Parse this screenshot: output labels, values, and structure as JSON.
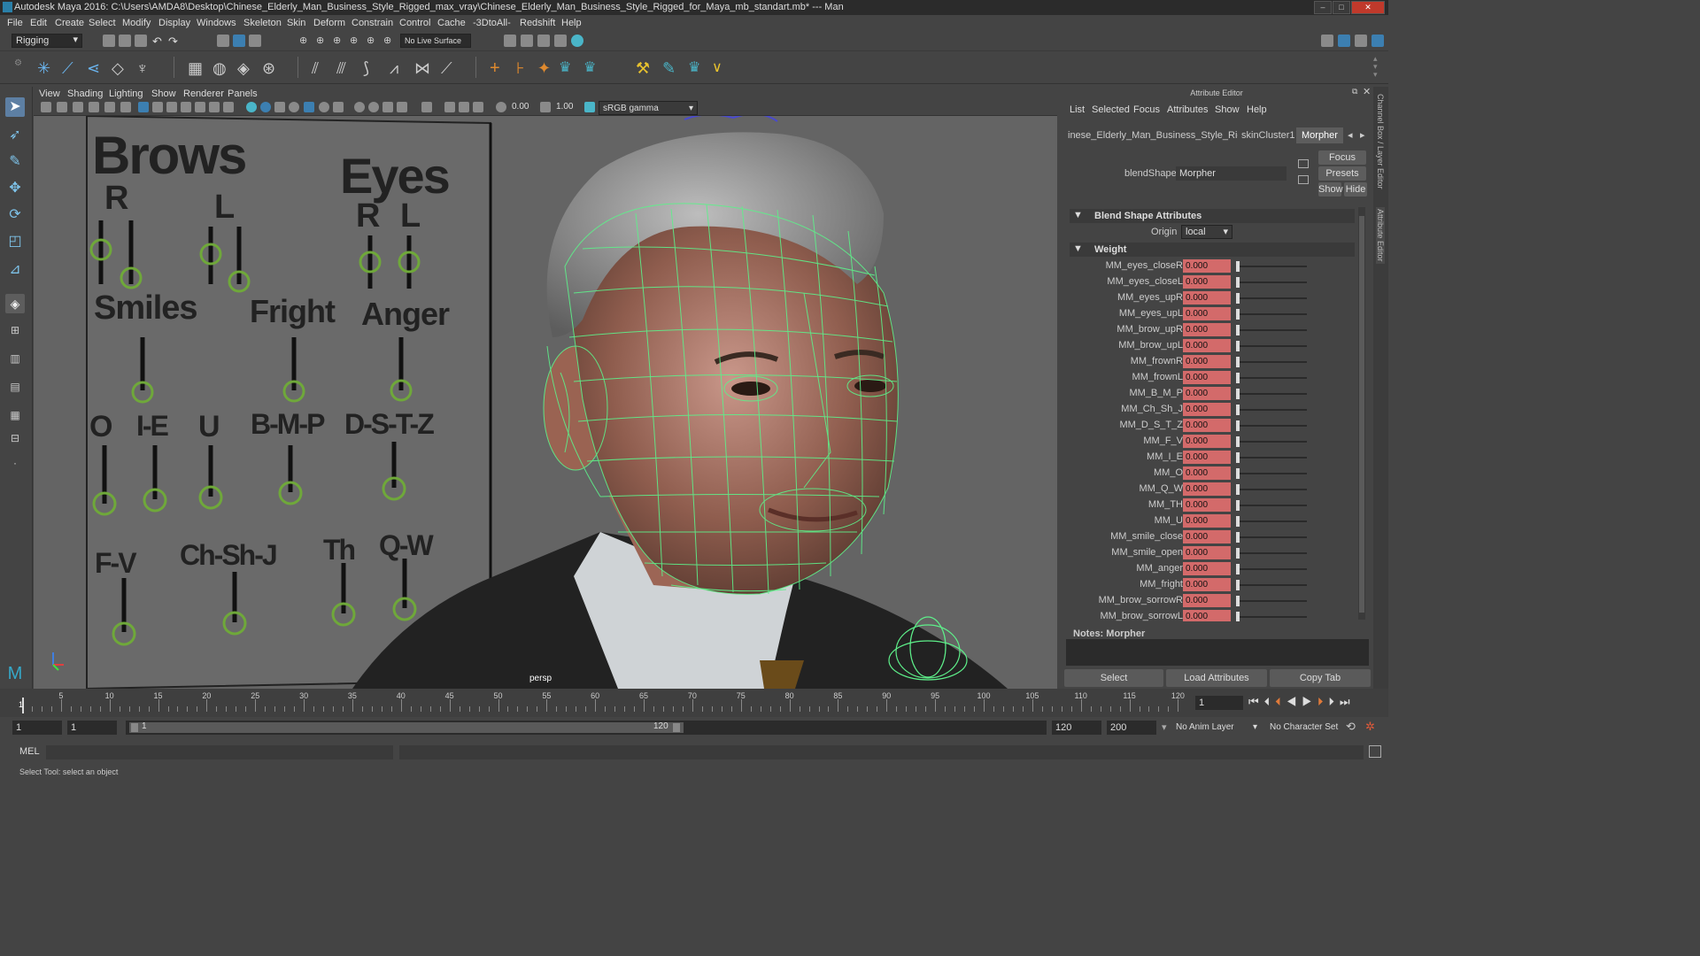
{
  "window": {
    "title": "Autodesk Maya 2016: C:\\Users\\AMDA8\\Desktop\\Chinese_Elderly_Man_Business_Style_Rigged_max_vray\\Chinese_Elderly_Man_Business_Style_Rigged_for_Maya_mb_standart.mb*   ---   Man",
    "controls": [
      "–",
      "□",
      "✕"
    ]
  },
  "menus": [
    "File",
    "Edit",
    "Create",
    "Select",
    "Modify",
    "Display",
    "Windows",
    "Skeleton",
    "Skin",
    "Deform",
    "Constrain",
    "Control",
    "Cache",
    "-3DtoAll-",
    "Redshift",
    "Help"
  ],
  "status_line": {
    "menu_set": "Rigging",
    "live_surface": "No Live Surface"
  },
  "viewport": {
    "menus": [
      "View",
      "Shading",
      "Lighting",
      "Show",
      "Renderer",
      "Panels"
    ],
    "near": "0.00",
    "far": "1.00",
    "color_space": "sRGB gamma",
    "camera_label": "persp",
    "facial_gui": {
      "headings": [
        "Brows",
        "Eyes",
        "R",
        "L",
        "R",
        "L",
        "Smiles",
        "Fright",
        "Anger",
        "O",
        "I-E",
        "U",
        "B-M-P",
        "D-S-T-Z",
        "F-V",
        "Ch-Sh-J",
        "Th",
        "Q-W"
      ]
    },
    "wire_color": "#5ef08a"
  },
  "attribute_editor": {
    "header": "Attribute Editor",
    "menus": [
      "List",
      "Selected",
      "Focus",
      "Attributes",
      "Show",
      "Help"
    ],
    "tabs": [
      "inese_Elderly_Man_Business_Style_Rigged",
      "skinCluster1",
      "Morpher"
    ],
    "active_tab": "Morpher",
    "blendshape_label": "blendShape:",
    "blendshape_value": "Morpher",
    "focus_button": "Focus",
    "presets_button": "Presets",
    "show_button": "Show",
    "hide_button": "Hide",
    "section_blend": "Blend Shape Attributes",
    "origin_label": "Origin",
    "origin_value": "local",
    "section_weight": "Weight",
    "weights": [
      {
        "name": "MM_eyes_closeR",
        "value": "0.000"
      },
      {
        "name": "MM_eyes_closeL",
        "value": "0.000"
      },
      {
        "name": "MM_eyes_upR",
        "value": "0.000"
      },
      {
        "name": "MM_eyes_upL",
        "value": "0.000"
      },
      {
        "name": "MM_brow_upR",
        "value": "0.000"
      },
      {
        "name": "MM_brow_upL",
        "value": "0.000"
      },
      {
        "name": "MM_frownR",
        "value": "0.000"
      },
      {
        "name": "MM_frownL",
        "value": "0.000"
      },
      {
        "name": "MM_B_M_P",
        "value": "0.000"
      },
      {
        "name": "MM_Ch_Sh_J",
        "value": "0.000"
      },
      {
        "name": "MM_D_S_T_Z",
        "value": "0.000"
      },
      {
        "name": "MM_F_V",
        "value": "0.000"
      },
      {
        "name": "MM_I_E",
        "value": "0.000"
      },
      {
        "name": "MM_O",
        "value": "0.000"
      },
      {
        "name": "MM_Q_W",
        "value": "0.000"
      },
      {
        "name": "MM_TH",
        "value": "0.000"
      },
      {
        "name": "MM_U",
        "value": "0.000"
      },
      {
        "name": "MM_smile_close",
        "value": "0.000"
      },
      {
        "name": "MM_smile_open",
        "value": "0.000"
      },
      {
        "name": "MM_anger",
        "value": "0.000"
      },
      {
        "name": "MM_fright",
        "value": "0.000"
      },
      {
        "name": "MM_brow_sorrowR",
        "value": "0.000"
      },
      {
        "name": "MM_brow_sorrowL",
        "value": "0.000"
      }
    ],
    "notes_label": "Notes:  Morpher",
    "bottom_buttons": [
      "Select",
      "Load Attributes",
      "Copy Tab"
    ],
    "side_tabs": [
      "Channel Box / Layer Editor",
      "Attribute Editor"
    ]
  },
  "timeline": {
    "tick_labels": [
      "5",
      "10",
      "15",
      "20",
      "25",
      "30",
      "35",
      "40",
      "45",
      "50",
      "55",
      "60",
      "65",
      "70",
      "75",
      "80",
      "85",
      "90",
      "95",
      "100",
      "105",
      "110",
      "115",
      "120"
    ],
    "start_marker": "1",
    "current_frame": "1"
  },
  "range": {
    "start": "1",
    "playback_start": "1",
    "slider_start": "1",
    "slider_end": "120",
    "playback_end": "120",
    "end": "200",
    "anim_layer": "No Anim Layer",
    "character_set": "No Character Set"
  },
  "command_line": {
    "language": "MEL"
  },
  "help_line": {
    "text": "Select Tool: select an object"
  },
  "icons": {
    "toolbox": [
      "select-tool-icon",
      "lasso-tool-icon",
      "paint-select-icon",
      "move-tool-icon",
      "rotate-tool-icon",
      "scale-tool-icon",
      "last-tool-icon",
      "soft-select-icon"
    ],
    "playback": [
      "go-start-icon",
      "step-back-key-icon",
      "step-back-icon",
      "play-back-icon",
      "play-forward-icon",
      "step-forward-icon",
      "step-forward-key-icon",
      "go-end-icon"
    ]
  }
}
